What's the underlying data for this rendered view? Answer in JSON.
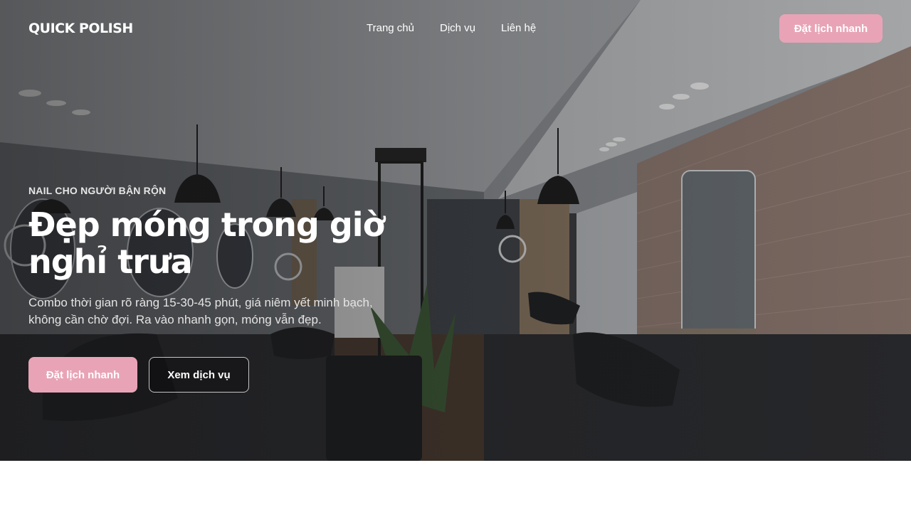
{
  "brand": {
    "logo": "QUICK POLISH"
  },
  "nav": {
    "links": [
      "Trang chủ",
      "Dịch vụ",
      "Liên hệ"
    ],
    "cta_label": "Đặt lịch nhanh"
  },
  "hero": {
    "eyebrow": "NAIL CHO NGƯỜI BẬN RỘN",
    "headline": "Đẹp móng trong giờ nghỉ trưa",
    "subtext": "Combo thời gian rõ ràng 15-30-45 phút, giá niêm yết minh bạch, không cần chờ đợi. Ra vào nhanh gọn, móng vẫn đẹp.",
    "primary_cta": "Đặt lịch nhanh",
    "secondary_cta": "Xem dịch vụ",
    "background": "salon-interior-photo"
  },
  "colors": {
    "accent": "#e8a4b6",
    "overlay": "#141416"
  }
}
